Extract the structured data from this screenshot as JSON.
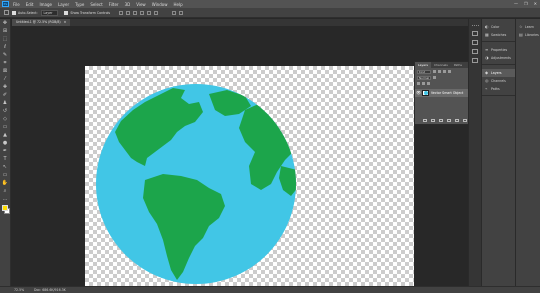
{
  "menubar": {
    "logo": "Ps",
    "items": [
      "File",
      "Edit",
      "Image",
      "Layer",
      "Type",
      "Select",
      "Filter",
      "3D",
      "View",
      "Window",
      "Help"
    ],
    "window_controls": [
      "—",
      "❐",
      "✕"
    ]
  },
  "options_bar": {
    "auto_select_label": "Auto-Select:",
    "auto_select_value": "Layer",
    "transform_controls_label": "Show Transform Controls"
  },
  "document": {
    "tab_title": "Untitled-1 @ 72.5% (RGB/8)",
    "tab_close": "×"
  },
  "globe": {
    "ocean_color": "#41c6e6",
    "land_color": "#1ca54b"
  },
  "status": {
    "zoom": "72.5%",
    "doc_info": "Doc: 686.6K/916.3K"
  },
  "layers_panel": {
    "tabs": [
      "Layers",
      "Channels",
      "Paths"
    ],
    "kind_label": "Kind",
    "blend_mode": "Normal",
    "layer_name": "Vector Smart Object",
    "eye_glyph": "👁"
  },
  "panel_column_1": {
    "groups": [
      [
        {
          "icon": "color-icon",
          "glyph": "◐",
          "label": "Color"
        },
        {
          "icon": "swatches-icon",
          "glyph": "▦",
          "label": "Swatches"
        }
      ],
      [
        {
          "icon": "properties-icon",
          "glyph": "≡",
          "label": "Properties"
        },
        {
          "icon": "adjustments-icon",
          "glyph": "◑",
          "label": "Adjustments"
        }
      ],
      [
        {
          "icon": "layers-icon",
          "glyph": "◆",
          "label": "Layers"
        },
        {
          "icon": "channels-icon",
          "glyph": "◎",
          "label": "Channels"
        },
        {
          "icon": "paths-icon",
          "glyph": "⌁",
          "label": "Paths"
        }
      ]
    ]
  },
  "panel_column_2": {
    "items": [
      {
        "icon": "learn-icon",
        "glyph": "☆",
        "label": "Learn"
      },
      {
        "icon": "libraries-icon",
        "glyph": "▤",
        "label": "Libraries"
      }
    ]
  },
  "toolbar": {
    "tools": [
      {
        "name": "move-tool",
        "glyph": "✥"
      },
      {
        "name": "artboard-tool",
        "glyph": "⊞"
      },
      {
        "name": "marquee-tool",
        "glyph": "⬚"
      },
      {
        "name": "lasso-tool",
        "glyph": "ℓ"
      },
      {
        "name": "quick-select-tool",
        "glyph": "✎"
      },
      {
        "name": "crop-tool",
        "glyph": "⌗"
      },
      {
        "name": "frame-tool",
        "glyph": "⊠"
      },
      {
        "name": "eyedropper-tool",
        "glyph": "⁄"
      },
      {
        "name": "healing-tool",
        "glyph": "✚"
      },
      {
        "name": "brush-tool",
        "glyph": "✐"
      },
      {
        "name": "clone-stamp-tool",
        "glyph": "♟"
      },
      {
        "name": "history-brush-tool",
        "glyph": "↺"
      },
      {
        "name": "eraser-tool",
        "glyph": "◇"
      },
      {
        "name": "gradient-tool",
        "glyph": "▭"
      },
      {
        "name": "blur-tool",
        "glyph": "▲"
      },
      {
        "name": "dodge-tool",
        "glyph": "●"
      },
      {
        "name": "pen-tool",
        "glyph": "✒"
      },
      {
        "name": "type-tool",
        "glyph": "T"
      },
      {
        "name": "path-select-tool",
        "glyph": "↖"
      },
      {
        "name": "rectangle-tool",
        "glyph": "▭"
      },
      {
        "name": "hand-tool",
        "glyph": "✋"
      },
      {
        "name": "zoom-tool",
        "glyph": "⌕"
      },
      {
        "name": "more-tools",
        "glyph": "…"
      }
    ],
    "foreground_color": "#ffde00",
    "background_color": "#ffffff"
  }
}
